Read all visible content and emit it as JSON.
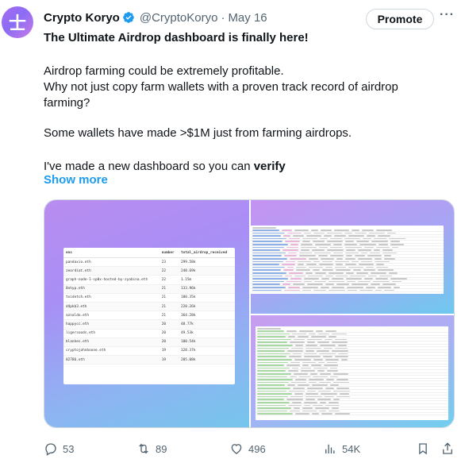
{
  "author": {
    "name": "Crypto Koryo",
    "handle": "@CryptoKoryo",
    "separator": "·",
    "date": "May 16",
    "avatar_glyph": "士"
  },
  "promote_label": "Promote",
  "more_glyph": "···",
  "tweet": {
    "line1": "The Ultimate Airdrop dashboard is finally here!",
    "line2": "Airdrop farming could be extremely profitable.",
    "line3": "Why not just copy farm wallets with a proven track record of airdrop",
    "line4": "farming?",
    "line5": "Some wallets have made >$1M just from farming airdrops.",
    "line6_prefix": "I've made a new dashboard so you can ",
    "line6_bold": "verify",
    "show_more": "Show more"
  },
  "media": {
    "table": {
      "headers": [
        "ens",
        "number",
        "total_airdrop_received"
      ],
      "rows": [
        [
          "pandaxio.eth",
          "23",
          "299.58k"
        ],
        [
          "zeordiat.eth",
          "22",
          "248.69k"
        ],
        [
          "graph-node-1-cp0x-hosted-by-zyabina.eth",
          "22",
          "1.15m"
        ],
        [
          "0xhyp.eth",
          "21",
          "133.96k"
        ],
        [
          "txidetch.eth",
          "21",
          "180.35k"
        ],
        [
          "d4pkb3.eth",
          "21",
          "220.26k"
        ],
        [
          "aznaldo.eth",
          "21",
          "364.28k"
        ],
        [
          "happycc.eth",
          "20",
          "48.77k"
        ],
        [
          "ligersoods.eth",
          "20",
          "49.53k"
        ],
        [
          "blankes.eth",
          "20",
          "100.54k"
        ],
        [
          "cryptojohnboone.eth",
          "19",
          "328.37k"
        ],
        [
          "02786.eth",
          "19",
          "205.08k"
        ]
      ]
    }
  },
  "actions": {
    "replies": "53",
    "reposts": "89",
    "likes": "496",
    "views": "54K"
  },
  "colors": {
    "accent": "#1d9bf0",
    "muted": "#536471",
    "text": "#0f1419",
    "verified": "#1d9bf0"
  }
}
